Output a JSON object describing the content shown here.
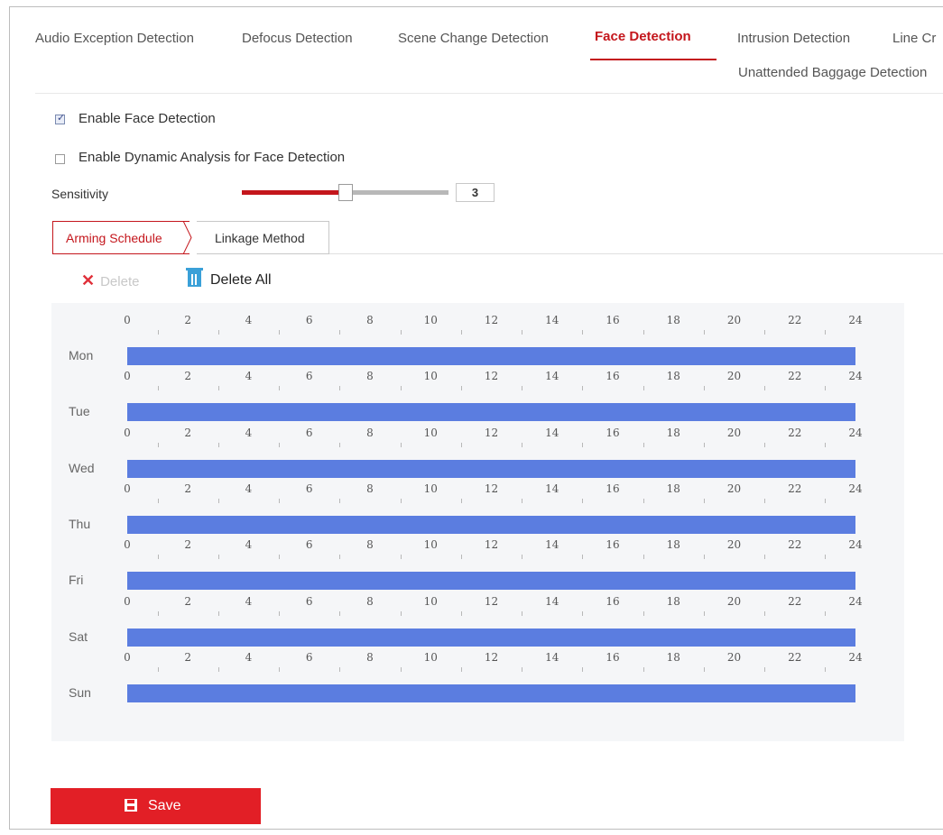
{
  "tabs": [
    {
      "label": "Audio Exception Detection",
      "active": false
    },
    {
      "label": "Defocus Detection",
      "active": false
    },
    {
      "label": "Scene Change Detection",
      "active": false
    },
    {
      "label": "Face Detection",
      "active": true
    },
    {
      "label": "Intrusion Detection",
      "active": false
    },
    {
      "label": "Line Cr",
      "active": false
    },
    {
      "label": "Unattended Baggage Detection",
      "active": false
    }
  ],
  "settings": {
    "enable_face_detection": {
      "label": "Enable Face Detection",
      "checked": true
    },
    "enable_dynamic_analysis": {
      "label": "Enable Dynamic Analysis for Face Detection",
      "checked": false
    },
    "sensitivity": {
      "label": "Sensitivity",
      "value": "3",
      "level": 0.4
    }
  },
  "subtabs": {
    "arming_schedule": "Arming Schedule",
    "linkage_method": "Linkage Method"
  },
  "toolbar": {
    "delete_label": "Delete",
    "delete_all_label": "Delete All"
  },
  "schedule": {
    "hours": [
      "0",
      "2",
      "4",
      "6",
      "8",
      "10",
      "12",
      "14",
      "16",
      "18",
      "20",
      "22",
      "24"
    ],
    "days": [
      {
        "label": "Mon",
        "start": 0,
        "end": 24
      },
      {
        "label": "Tue",
        "start": 0,
        "end": 24
      },
      {
        "label": "Wed",
        "start": 0,
        "end": 24
      },
      {
        "label": "Thu",
        "start": 0,
        "end": 24
      },
      {
        "label": "Fri",
        "start": 0,
        "end": 24
      },
      {
        "label": "Sat",
        "start": 0,
        "end": 24
      },
      {
        "label": "Sun",
        "start": 0,
        "end": 24
      }
    ],
    "bar_color": "#5b7de0"
  },
  "footer": {
    "save_label": "Save"
  },
  "colors": {
    "accent": "#c4161c",
    "save_button": "#e21f26"
  }
}
